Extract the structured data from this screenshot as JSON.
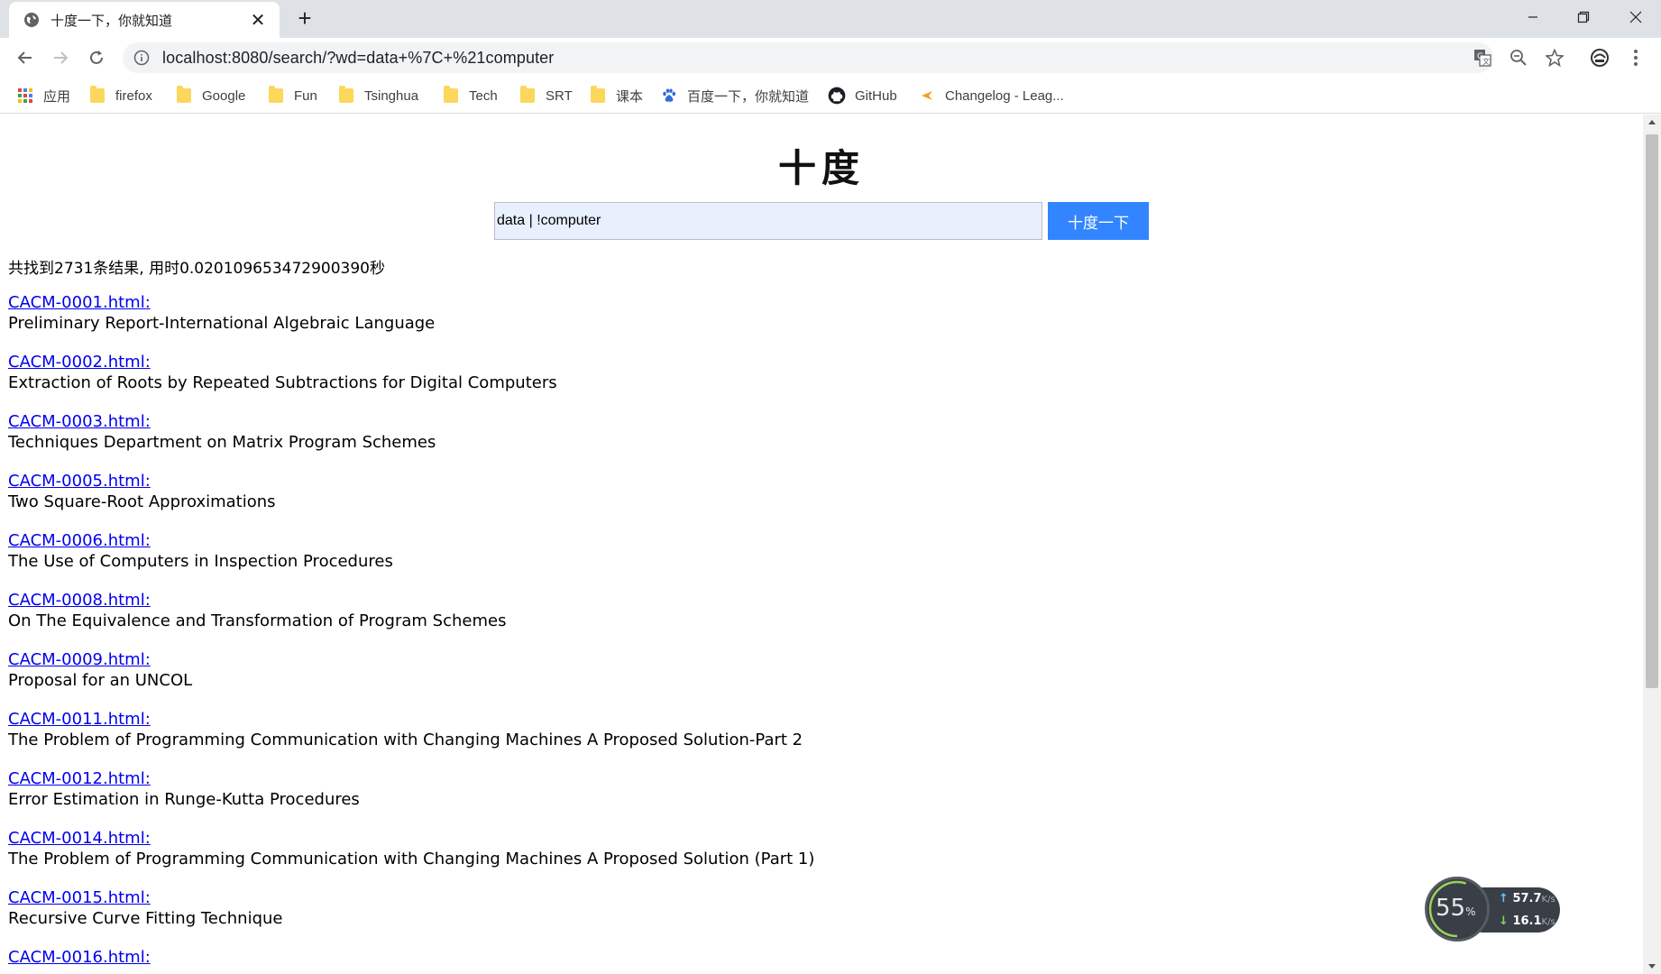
{
  "tab": {
    "title": "十度一下，你就知道",
    "close": "✕"
  },
  "newtab": "+",
  "address": {
    "url": "localhost:8080/search/?wd=data+%7C+%21computer"
  },
  "bookmarks": [
    {
      "label": "应用",
      "icon": "apps-grid-icon"
    },
    {
      "label": "firefox",
      "icon": "folder-icon"
    },
    {
      "label": "Google",
      "icon": "folder-icon"
    },
    {
      "label": "Fun",
      "icon": "folder-icon"
    },
    {
      "label": "Tsinghua",
      "icon": "folder-icon"
    },
    {
      "label": "Tech",
      "icon": "folder-icon"
    },
    {
      "label": "SRT",
      "icon": "folder-icon"
    },
    {
      "label": "课本",
      "icon": "folder-icon"
    },
    {
      "label": "百度一下，你就知道",
      "icon": "baidu-paw-icon"
    },
    {
      "label": "GitHub",
      "icon": "github-icon"
    },
    {
      "label": "Changelog - Leag...",
      "icon": "changelog-icon"
    }
  ],
  "page": {
    "logo": "十度",
    "search": {
      "value": "data | !computer",
      "button": "十度一下"
    },
    "stats": "共找到2731条结果, 用时0.020109653472900390秒",
    "results": [
      {
        "link": "CACM-0001.html:",
        "title": "Preliminary Report-International Algebraic Language"
      },
      {
        "link": "CACM-0002.html:",
        "title": "Extraction of Roots by Repeated Subtractions for Digital Computers"
      },
      {
        "link": "CACM-0003.html:",
        "title": "Techniques Department on Matrix Program Schemes"
      },
      {
        "link": "CACM-0005.html:",
        "title": "Two Square-Root Approximations"
      },
      {
        "link": "CACM-0006.html:",
        "title": "The Use of Computers in Inspection Procedures"
      },
      {
        "link": "CACM-0008.html:",
        "title": "On The Equivalence and Transformation of Program Schemes"
      },
      {
        "link": "CACM-0009.html:",
        "title": "Proposal for an UNCOL"
      },
      {
        "link": "CACM-0011.html:",
        "title": "The Problem of Programming Communication with Changing Machines A Proposed Solution-Part 2"
      },
      {
        "link": "CACM-0012.html:",
        "title": "Error Estimation in Runge-Kutta Procedures"
      },
      {
        "link": "CACM-0014.html:",
        "title": "The Problem of Programming Communication with Changing Machines A Proposed Solution (Part 1)"
      },
      {
        "link": "CACM-0015.html:",
        "title": "Recursive Curve Fitting Technique"
      },
      {
        "link": "CACM-0016.html:",
        "title": ""
      }
    ]
  },
  "netwidget": {
    "percent": "55",
    "percent_sign": "%",
    "up": "57.7",
    "down": "16.1",
    "unit": "K/s"
  },
  "colors": {
    "link": "#0000ee",
    "button": "#3385ff",
    "input_bg": "#e8f0fe"
  }
}
